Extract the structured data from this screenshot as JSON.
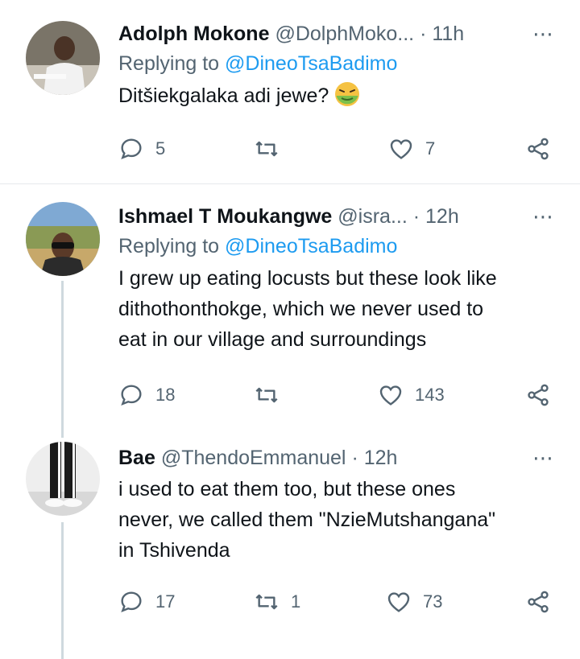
{
  "tweets": [
    {
      "name": "Adolph Mokone",
      "handle": "@DolphMoko...",
      "dot": "·",
      "time": "11h",
      "replying_prefix": "Replying to",
      "replying_to": "@DineoTsaBadimo",
      "text": "Ditšiekgalaka adi jewe?",
      "emoji": "nauseated-face-emoji",
      "replies": "5",
      "retweets": "",
      "likes": "7"
    },
    {
      "name": "Ishmael T Moukangwe",
      "handle": "@isra...",
      "dot": "·",
      "time": "12h",
      "replying_prefix": "Replying to",
      "replying_to": "@DineoTsaBadimo",
      "text_lines": [
        "I grew up eating locusts but these look like",
        "dithothonthokge, which we never used to",
        "eat in our village and surroundings"
      ],
      "replies": "18",
      "retweets": "",
      "likes": "143"
    },
    {
      "name": "Bae",
      "handle": "@ThendoEmmanuel",
      "dot": "·",
      "time": "12h",
      "text_lines": [
        "i used to eat them too, but these ones",
        "never, we called them \"NzieMutshangana\"",
        "in Tshivenda"
      ],
      "replies": "17",
      "retweets": "1",
      "likes": "73"
    }
  ],
  "more_icon": "⋯",
  "colors": {
    "accent": "#1d9bf0",
    "secondary": "#536471",
    "text": "#0f1419",
    "divider": "#e6e9ec",
    "thread_line": "#cfd9de"
  }
}
